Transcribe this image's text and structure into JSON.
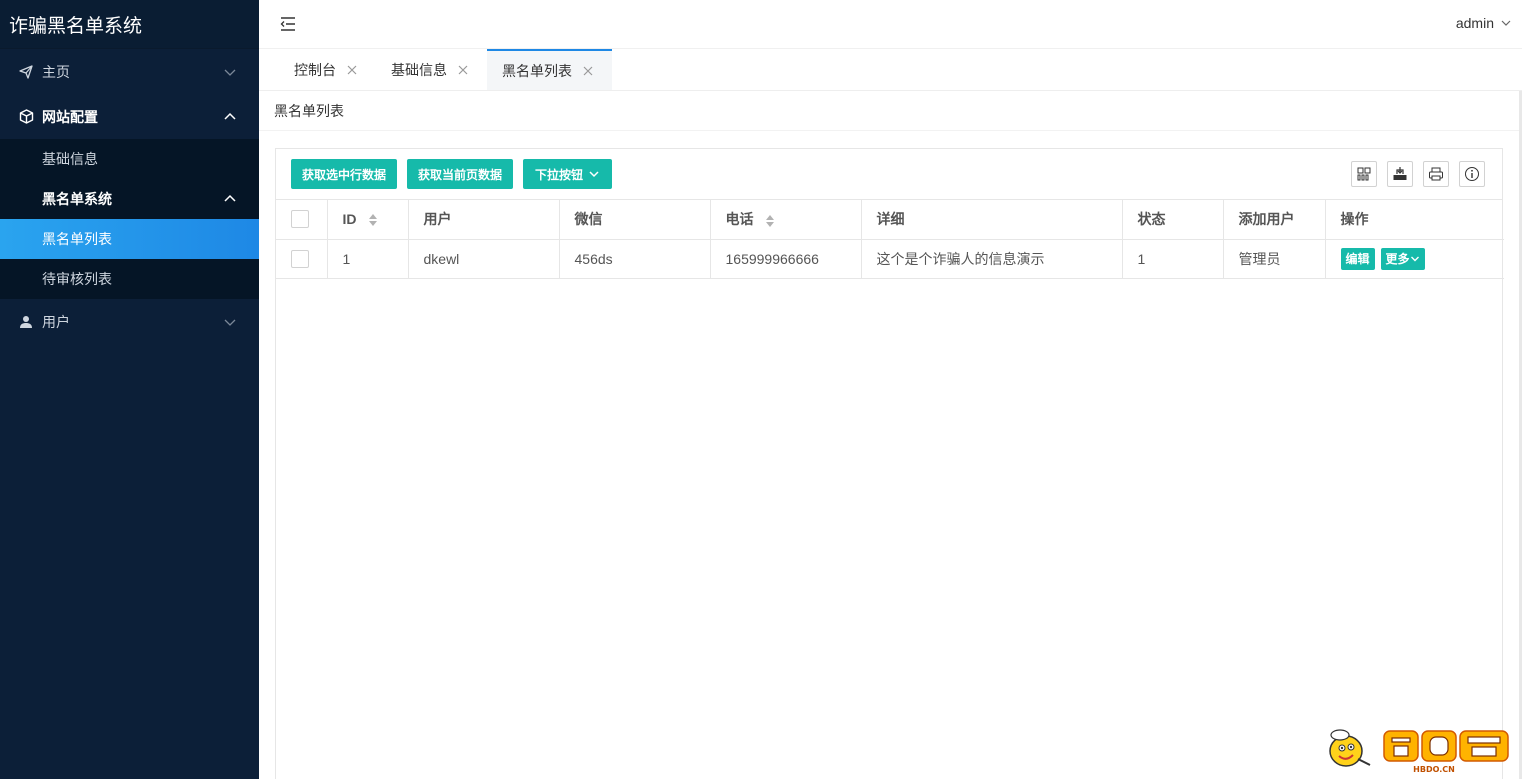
{
  "app": {
    "title": "诈骗黑名单系统",
    "user": "admin"
  },
  "sidebar": {
    "home": "主页",
    "site_config": "网站配置",
    "basic_info": "基础信息",
    "blacklist_system": "黑名单系统",
    "blacklist_list": "黑名单列表",
    "pending_review": "待审核列表",
    "users": "用户"
  },
  "tabs": [
    {
      "label": "控制台"
    },
    {
      "label": "基础信息"
    },
    {
      "label": "黑名单列表",
      "active": true
    }
  ],
  "breadcrumb": "黑名单列表",
  "toolbar": {
    "get_selected": "获取选中行数据",
    "get_page": "获取当前页数据",
    "dropdown": "下拉按钮"
  },
  "table": {
    "columns": [
      "ID",
      "用户",
      "微信",
      "电话",
      "详细",
      "状态",
      "添加用户",
      "操作"
    ],
    "rows": [
      {
        "id": "1",
        "user": "dkewl",
        "wechat": "456ds",
        "phone": "165999966666",
        "detail": "这个是个诈骗人的信息演示",
        "status": "1",
        "added_by": "管理员"
      }
    ],
    "edit_label": "编辑",
    "more_label": "更多"
  },
  "watermark": "HBDO.CN",
  "colors": {
    "sidebar_bg": "#0c1f38",
    "accent": "#1e88e5",
    "button": "#16baaa"
  }
}
